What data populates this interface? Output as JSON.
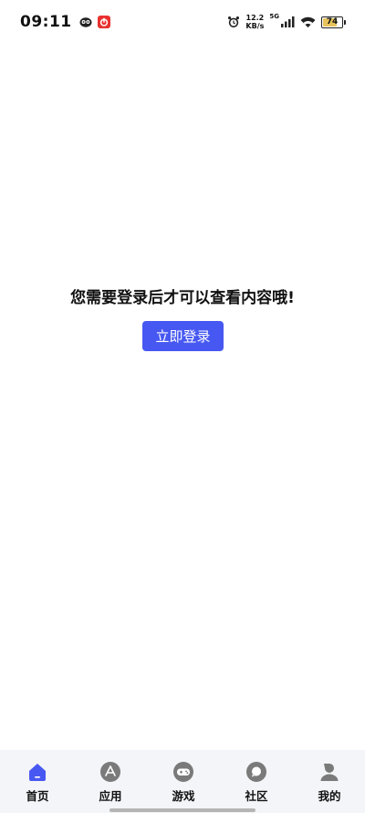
{
  "status_bar": {
    "time": "09:11",
    "network_speed_value": "12.2",
    "network_speed_unit": "KB/s",
    "network_type": "5G",
    "battery_level": "74",
    "battery_fraction": 0.74
  },
  "main": {
    "message": "您需要登录后才可以查看内容哦!",
    "login_button_label": "立即登录"
  },
  "tab_bar": {
    "tabs": [
      {
        "label": "首页",
        "icon": "home-icon",
        "active": true
      },
      {
        "label": "应用",
        "icon": "apps-icon",
        "active": false
      },
      {
        "label": "游戏",
        "icon": "gamepad-icon",
        "active": false
      },
      {
        "label": "社区",
        "icon": "chat-icon",
        "active": false
      },
      {
        "label": "我的",
        "icon": "profile-icon",
        "active": false
      }
    ]
  },
  "colors": {
    "accent": "#4758f2",
    "tab_icon_inactive": "#7a7a7a",
    "tab_bar_bg": "#f4f5f8"
  }
}
